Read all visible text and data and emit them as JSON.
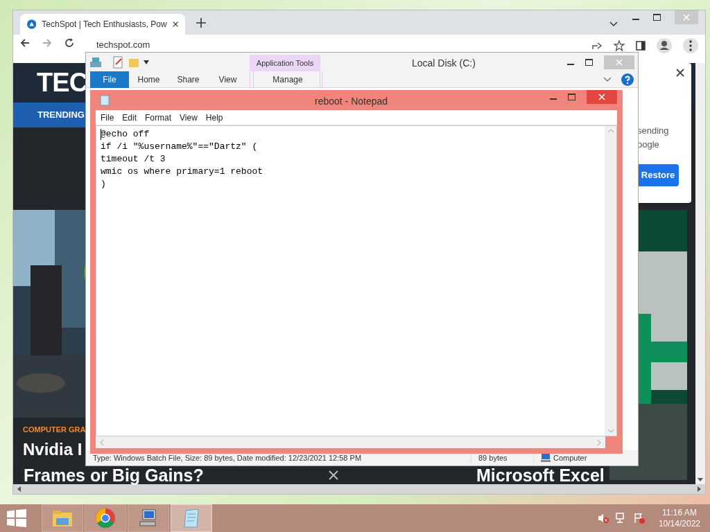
{
  "browser": {
    "tab_title": "TechSpot | Tech Enthusiasts, Pow",
    "address": "techspot.com",
    "site": {
      "logo": "TEC",
      "nav": "TRENDING",
      "category": "COMPUTER GRA",
      "headline_left": [
        "Nvidia I",
        "Frames or Big Gains?"
      ],
      "headline_right": "Microsoft Excel",
      "popup": {
        "lines": [
          "sending",
          "oogle"
        ],
        "button": "Restore"
      }
    }
  },
  "explorer": {
    "title": "Local Disk (C:)",
    "context_group": "Application Tools",
    "ribbon_tabs": [
      {
        "label": "File",
        "kind": "file"
      },
      {
        "label": "Home",
        "kind": "tab"
      },
      {
        "label": "Share",
        "kind": "tab"
      },
      {
        "label": "View",
        "kind": "tab"
      },
      {
        "label": "Manage",
        "kind": "context"
      }
    ],
    "status": [
      "Type: Windows Batch File, Size: 89 bytes, Date modified: 12/23/2021 12:58 PM",
      "89 bytes",
      "Computer"
    ]
  },
  "notepad": {
    "title": "reboot - Notepad",
    "menu": [
      "File",
      "Edit",
      "Format",
      "View",
      "Help"
    ],
    "lines": [
      "@echo off",
      "if /i \"%username%\"==\"Dartz\" (",
      "timeout /t 3",
      "wmic os where primary=1 reboot",
      ")"
    ]
  },
  "taskbar": {
    "apps": [
      {
        "kind": "folder",
        "selected": false
      },
      {
        "kind": "chrome",
        "selected": false
      },
      {
        "kind": "computer",
        "selected": false
      },
      {
        "kind": "notepad",
        "selected": true
      }
    ],
    "time": "11:16 AM",
    "date": "10/14/2022"
  }
}
